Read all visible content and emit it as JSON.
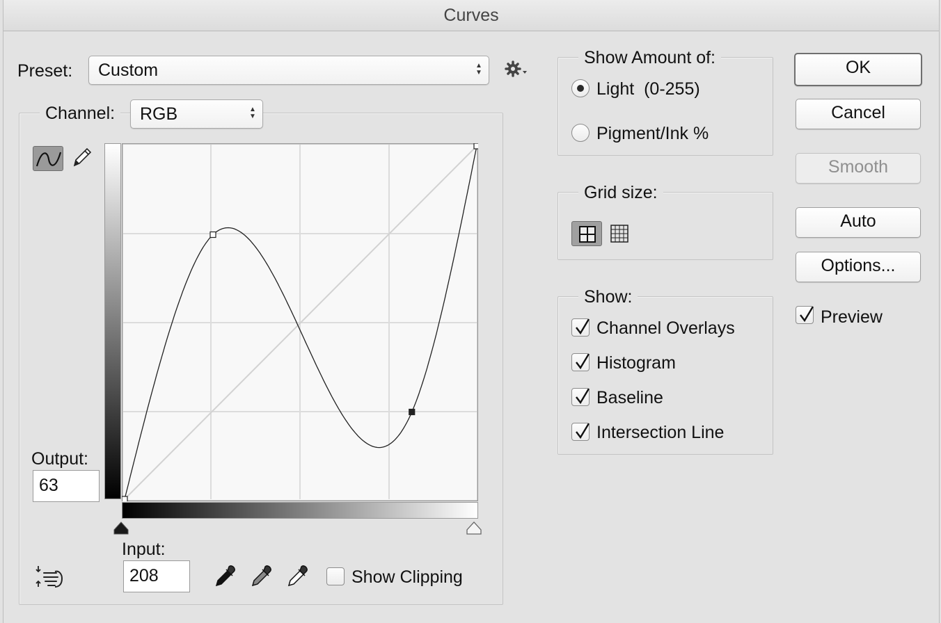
{
  "window": {
    "title": "Curves"
  },
  "preset": {
    "label": "Preset:",
    "value": "Custom"
  },
  "channel": {
    "label": "Channel:",
    "value": "RGB"
  },
  "output": {
    "label": "Output:",
    "value": "63"
  },
  "input": {
    "label": "Input:",
    "value": "208"
  },
  "show_clipping": {
    "label": "Show Clipping",
    "checked": false
  },
  "show_amount": {
    "title": "Show Amount of:",
    "options": [
      {
        "label": "Light  (0-255)",
        "selected": true
      },
      {
        "label": "Pigment/Ink %",
        "selected": false
      }
    ]
  },
  "grid_size": {
    "title": "Grid size:",
    "selected": "simple"
  },
  "show": {
    "title": "Show:",
    "items": [
      {
        "label": "Channel Overlays",
        "checked": true
      },
      {
        "label": "Histogram",
        "checked": true
      },
      {
        "label": "Baseline",
        "checked": true
      },
      {
        "label": "Intersection Line",
        "checked": true
      }
    ]
  },
  "buttons": {
    "ok": "OK",
    "cancel": "Cancel",
    "smooth": "Smooth",
    "auto": "Auto",
    "options": "Options..."
  },
  "preview": {
    "label": "Preview",
    "checked": true
  },
  "curve": {
    "points": [
      [
        0,
        0
      ],
      [
        64,
        191
      ],
      [
        208,
        63
      ],
      [
        255,
        255
      ]
    ],
    "selected_point": 2
  }
}
